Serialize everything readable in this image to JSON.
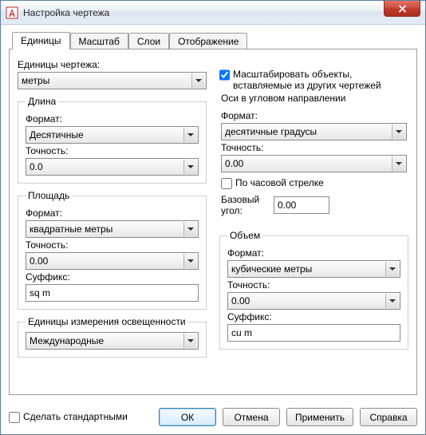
{
  "window": {
    "title": "Настройка чертежа"
  },
  "tabs": {
    "units": "Единицы",
    "scale": "Масштаб",
    "layers": "Слои",
    "display": "Отображение"
  },
  "units": {
    "drawing_units_label": "Единицы чертежа:",
    "drawing_units_value": "метры"
  },
  "length": {
    "legend": "Длина",
    "format_label": "Формат:",
    "format_value": "Десятичные",
    "precision_label": "Точность:",
    "precision_value": "0.0"
  },
  "area": {
    "legend": "Площадь",
    "format_label": "Формат:",
    "format_value": "квадратные метры",
    "precision_label": "Точность:",
    "precision_value": "0.00",
    "suffix_label": "Суффикс:",
    "suffix_value": "sq m"
  },
  "lighting": {
    "legend": "Единицы измерения освещенности",
    "value": "Международные"
  },
  "scale_insert": {
    "label": "Масштабировать объекты, вставляемые из других чертежей",
    "checked": true
  },
  "angle": {
    "legend": "Оси в угловом направлении",
    "format_label": "Формат:",
    "format_value": "десятичные градусы",
    "precision_label": "Точность:",
    "precision_value": "0.00",
    "clockwise_label": "По часовой стрелке",
    "clockwise_checked": false,
    "base_angle_label": "Базовый угол:",
    "base_angle_value": "0.00"
  },
  "volume": {
    "legend": "Объем",
    "format_label": "Формат:",
    "format_value": "кубические метры",
    "precision_label": "Точность:",
    "precision_value": "0.00",
    "suffix_label": "Суффикс:",
    "suffix_value": "cu m"
  },
  "footer": {
    "make_default_label": "Сделать стандартными",
    "make_default_checked": false,
    "ok": "ОК",
    "cancel": "Отмена",
    "apply": "Применить",
    "help": "Справка"
  }
}
